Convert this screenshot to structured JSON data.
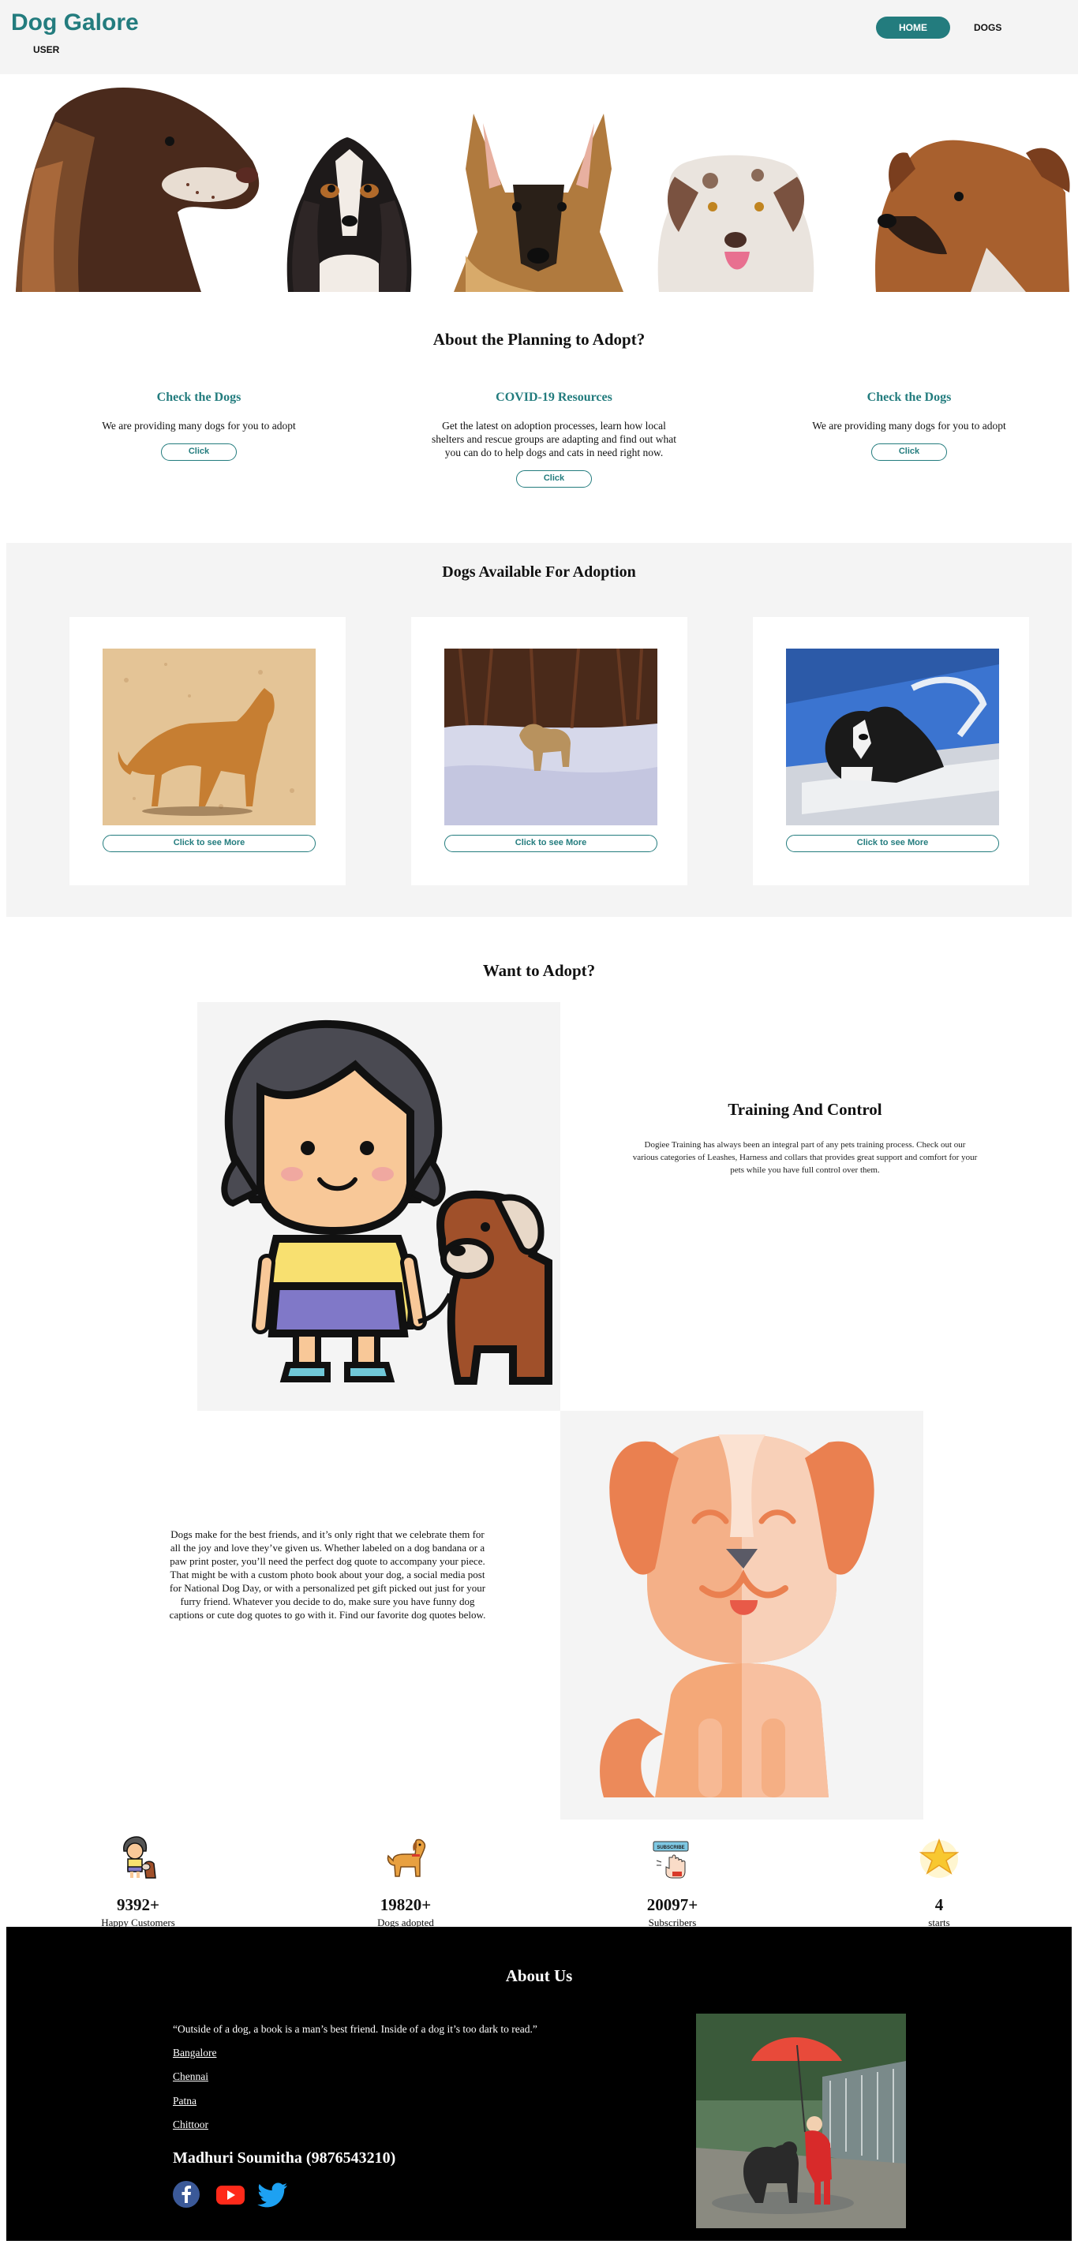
{
  "header": {
    "brand": "Dog Galore",
    "user_link": "USER",
    "nav": {
      "home": "HOME",
      "dogs": "DOGS"
    }
  },
  "planning": {
    "title": "About the Planning to Adopt?",
    "cards": [
      {
        "title": "Check the Dogs",
        "text": "We are providing many dogs for you to adopt",
        "button": "Click"
      },
      {
        "title": "COVID-19 Resources",
        "text": "Get the latest on adoption processes, learn how local shelters and rescue groups are adapting and find out what you can do to help dogs and cats in need right now.",
        "button": "Click"
      },
      {
        "title": "Check the Dogs",
        "text": "We are providing many dogs for you to adopt",
        "button": "Click"
      }
    ]
  },
  "adoption": {
    "title": "Dogs Available For Adoption",
    "cards": [
      {
        "button": "Click to see More"
      },
      {
        "button": "Click to see More"
      },
      {
        "button": "Click to see More"
      }
    ]
  },
  "want": {
    "title": "Want to Adopt?",
    "training_title": "Training And Control",
    "training_text": "Dogiee Training has always been an integral part of any pets training process. Check out our various categories of Leashes, Harness and collars that provides great support and comfort for your pets while you have full control over them.",
    "dog_text": "Dogs make for the best friends, and it’s only right that we celebrate them for all the joy and love they’ve given us. Whether labeled on a dog bandana or a paw print poster, you’ll need the perfect dog quote to accompany your piece. That might be with a custom photo book about your dog, a social media post for National Dog Day, or with a personalized pet gift picked out just for your furry friend. Whatever you decide to do, make sure you have funny dog captions or cute dog quotes to go with it. Find our favorite dog quotes below."
  },
  "stats": [
    {
      "icon": "girl-with-dog-icon",
      "value": "9392+",
      "label": "Happy Customers"
    },
    {
      "icon": "dog-icon",
      "value": "19820+",
      "label": "Dogs adopted"
    },
    {
      "icon": "subscribe-icon",
      "value": "20097+",
      "label": "Subscribers",
      "badge": "SUBSCRIBE"
    },
    {
      "icon": "star-icon",
      "value": "4",
      "label": "starts"
    }
  ],
  "about": {
    "title": "About Us",
    "quote": "“Outside of a dog, a book is a man’s best friend. Inside of a dog it’s too dark to read.”",
    "cities": [
      "Bangalore",
      "Chennai",
      "Patna",
      "Chittoor"
    ],
    "owner": "Madhuri Soumitha (9876543210)",
    "social": [
      "facebook-icon",
      "youtube-icon",
      "twitter-icon"
    ]
  },
  "colors": {
    "accent": "#237c7e",
    "panel": "#f4f4f4",
    "footer": "#000000"
  }
}
